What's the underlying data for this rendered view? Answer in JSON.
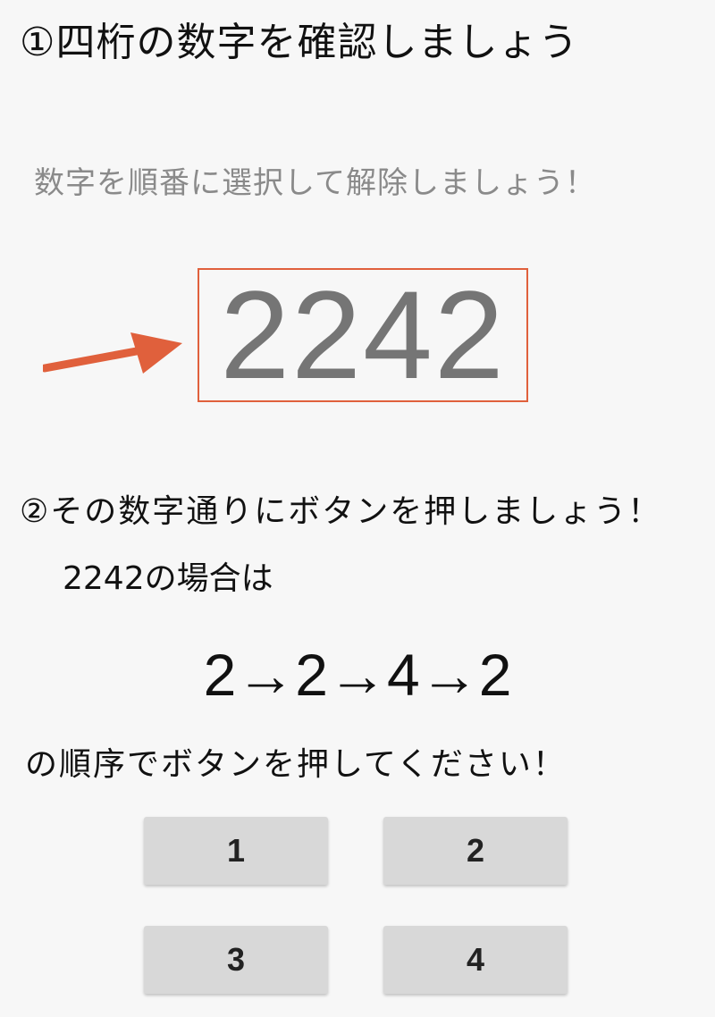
{
  "step1": {
    "title": "①四桁の数字を確認しましょう"
  },
  "lock_screen": {
    "instruction": "数字を順番に選択して解除しましょう！",
    "code": "2242"
  },
  "annotation": {
    "arrow_color": "#e0603c",
    "box_color": "#e0603c",
    "icon": "arrow-right-icon"
  },
  "step2": {
    "title": "②その数字通りにボタンを押しましょう！",
    "example_label": "2242の場合は",
    "sequence": "2→2→4→2",
    "press_note": "の順序でボタンを押してください！"
  },
  "keypad": {
    "buttons": [
      "1",
      "2",
      "3",
      "4"
    ]
  }
}
